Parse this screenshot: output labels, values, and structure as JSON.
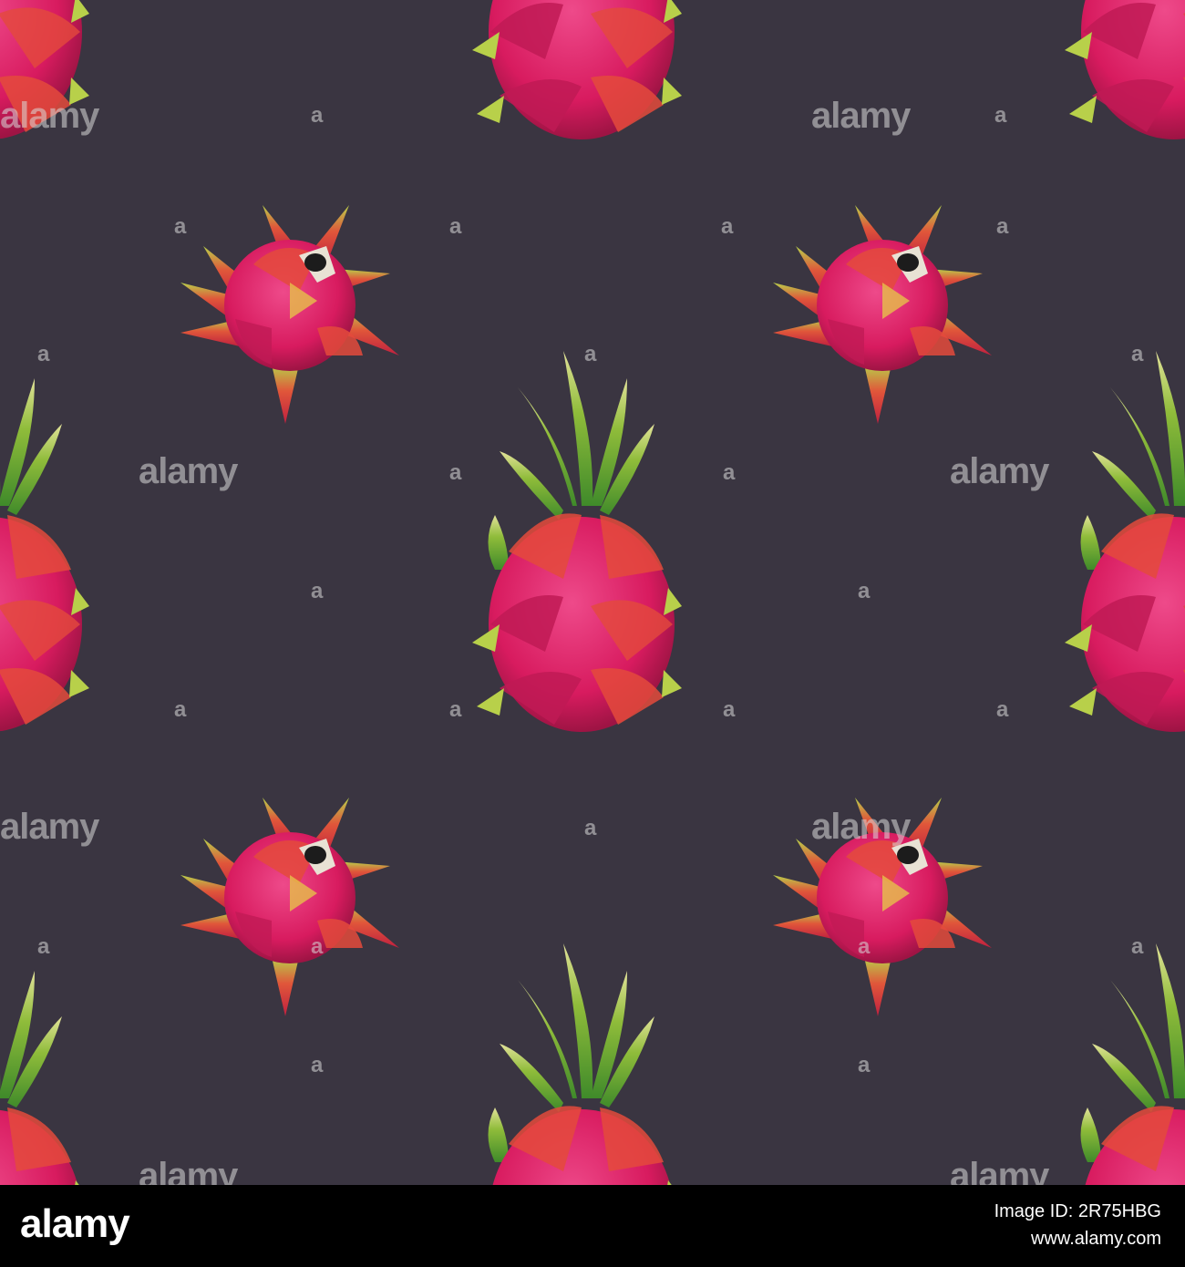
{
  "background_color": "#3a3541",
  "pattern": {
    "motifs": [
      "dragon-fruit-top-view",
      "dragon-fruit-side-view"
    ],
    "colors": {
      "skin": "#d81b5f",
      "scale": "#e0563a",
      "leaf": "#8fbc3a",
      "leaf_light": "#c9d96a"
    }
  },
  "watermark": {
    "word": "alamy",
    "letter": "a"
  },
  "footer": {
    "logo": "alamy",
    "image_id_label": "Image ID: 2R75HBG",
    "site": "www.alamy.com"
  }
}
